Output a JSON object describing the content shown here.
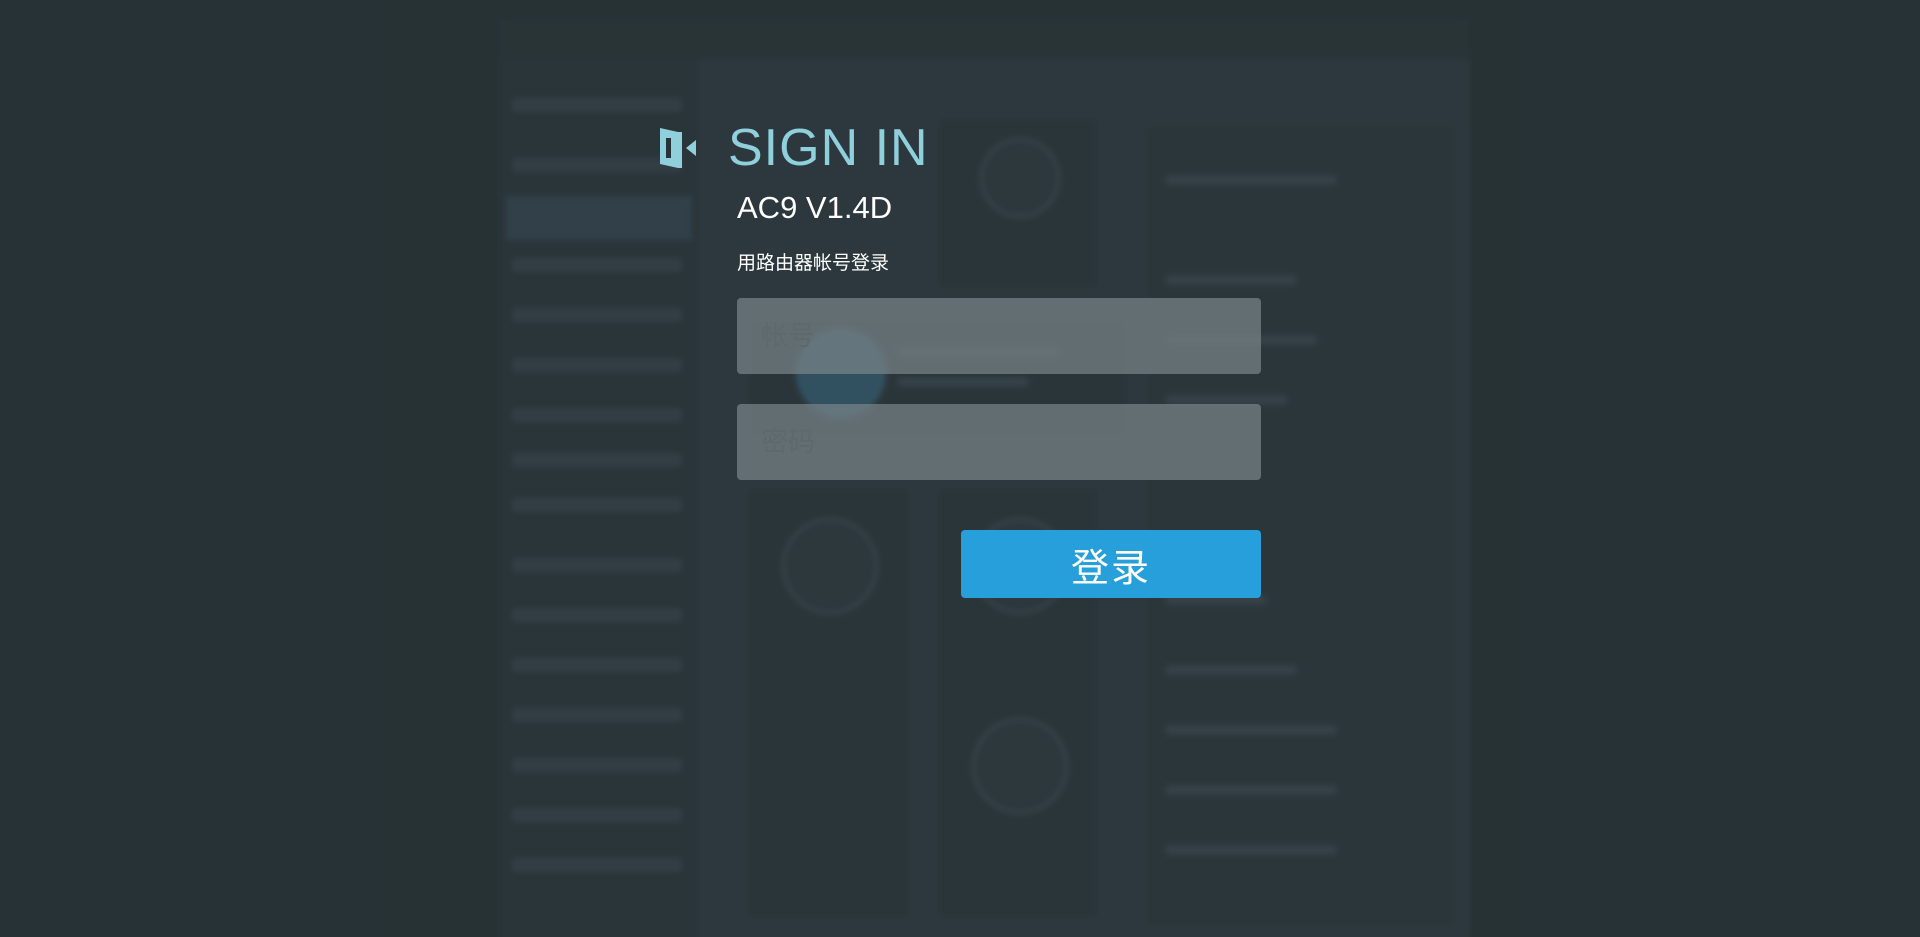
{
  "signin": {
    "title": "SIGN IN",
    "model": "AC9 V1.4D",
    "hint": "用路由器帐号登录",
    "icon": "door-exit-icon"
  },
  "form": {
    "account_placeholder": "帐号",
    "account_value": "",
    "password_placeholder": "密码",
    "password_value": "",
    "login_label": "登录"
  },
  "colors": {
    "background": "#283337",
    "title_accent": "#8fd0dc",
    "button": "#279fdb",
    "input_bg": "#788488"
  }
}
